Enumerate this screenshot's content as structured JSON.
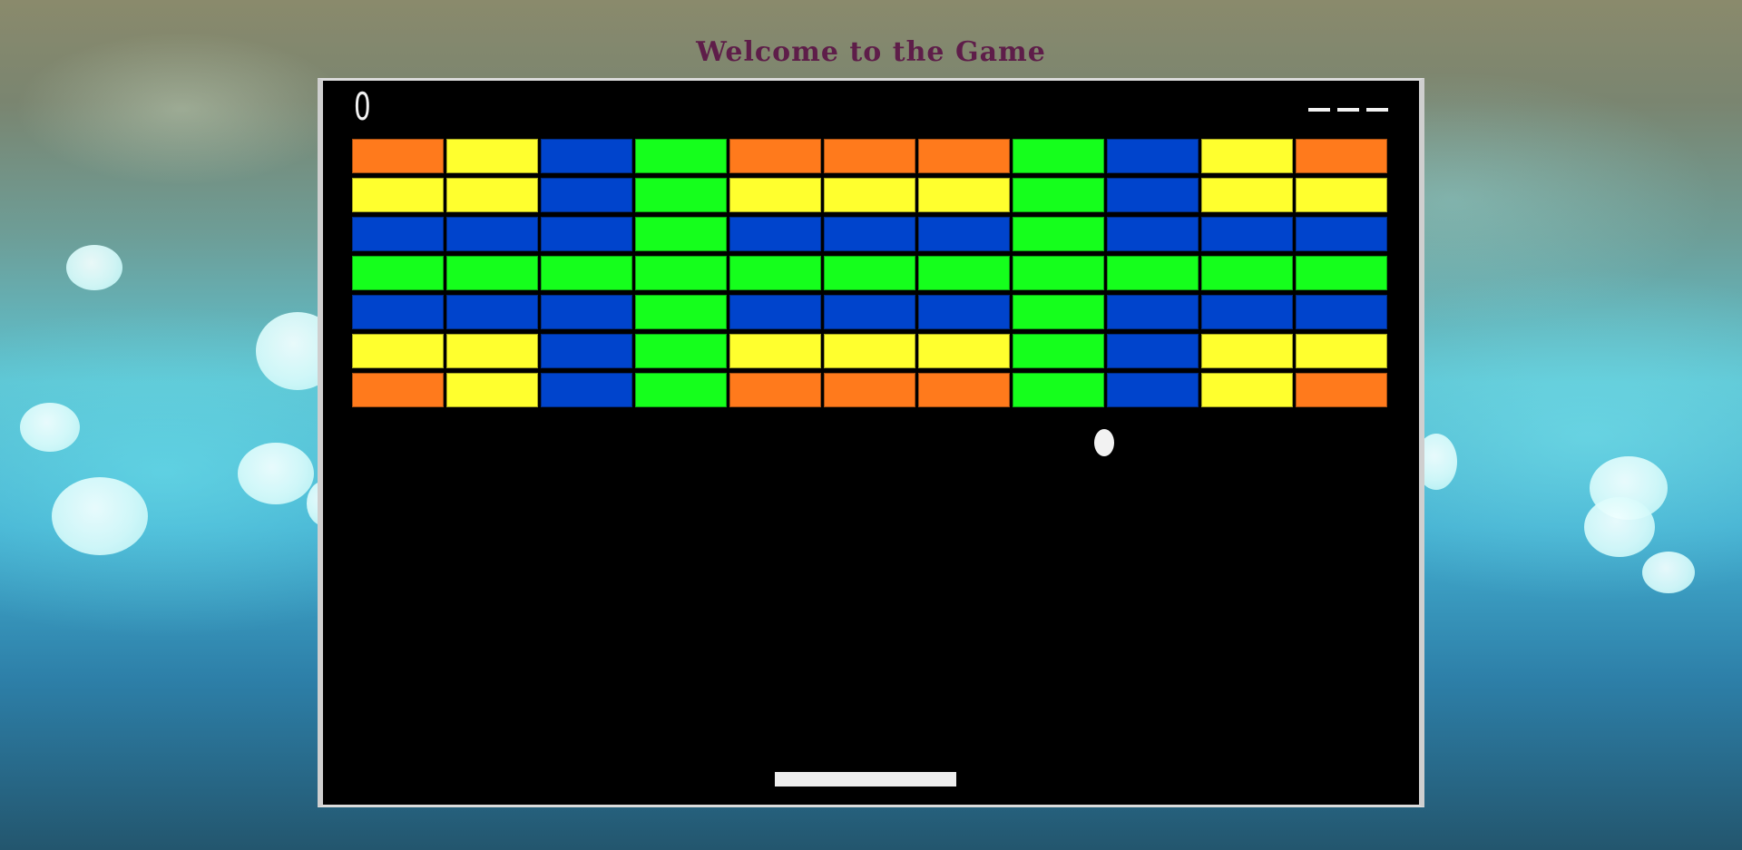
{
  "page": {
    "title": "Welcome to the Game"
  },
  "game": {
    "score": "0",
    "lives_remaining": 3,
    "colors": {
      "orange": "#ff7a1c",
      "yellow": "#ffff2e",
      "blue": "#0044cc",
      "green": "#15ff1c",
      "paddle": "#eeeeee",
      "ball": "#f2f2f2",
      "canvas_bg": "#000000"
    },
    "bricks": [
      [
        "orange",
        "yellow",
        "blue",
        "green",
        "orange",
        "orange",
        "orange",
        "green",
        "blue",
        "yellow",
        "orange"
      ],
      [
        "yellow",
        "yellow",
        "blue",
        "green",
        "yellow",
        "yellow",
        "yellow",
        "green",
        "blue",
        "yellow",
        "yellow"
      ],
      [
        "blue",
        "blue",
        "blue",
        "green",
        "blue",
        "blue",
        "blue",
        "green",
        "blue",
        "blue",
        "blue"
      ],
      [
        "green",
        "green",
        "green",
        "green",
        "green",
        "green",
        "green",
        "green",
        "green",
        "green",
        "green"
      ],
      [
        "blue",
        "blue",
        "blue",
        "green",
        "blue",
        "blue",
        "blue",
        "green",
        "blue",
        "blue",
        "blue"
      ],
      [
        "yellow",
        "yellow",
        "blue",
        "green",
        "yellow",
        "yellow",
        "yellow",
        "green",
        "blue",
        "yellow",
        "yellow"
      ],
      [
        "orange",
        "yellow",
        "blue",
        "green",
        "orange",
        "orange",
        "orange",
        "green",
        "blue",
        "yellow",
        "orange"
      ]
    ]
  }
}
